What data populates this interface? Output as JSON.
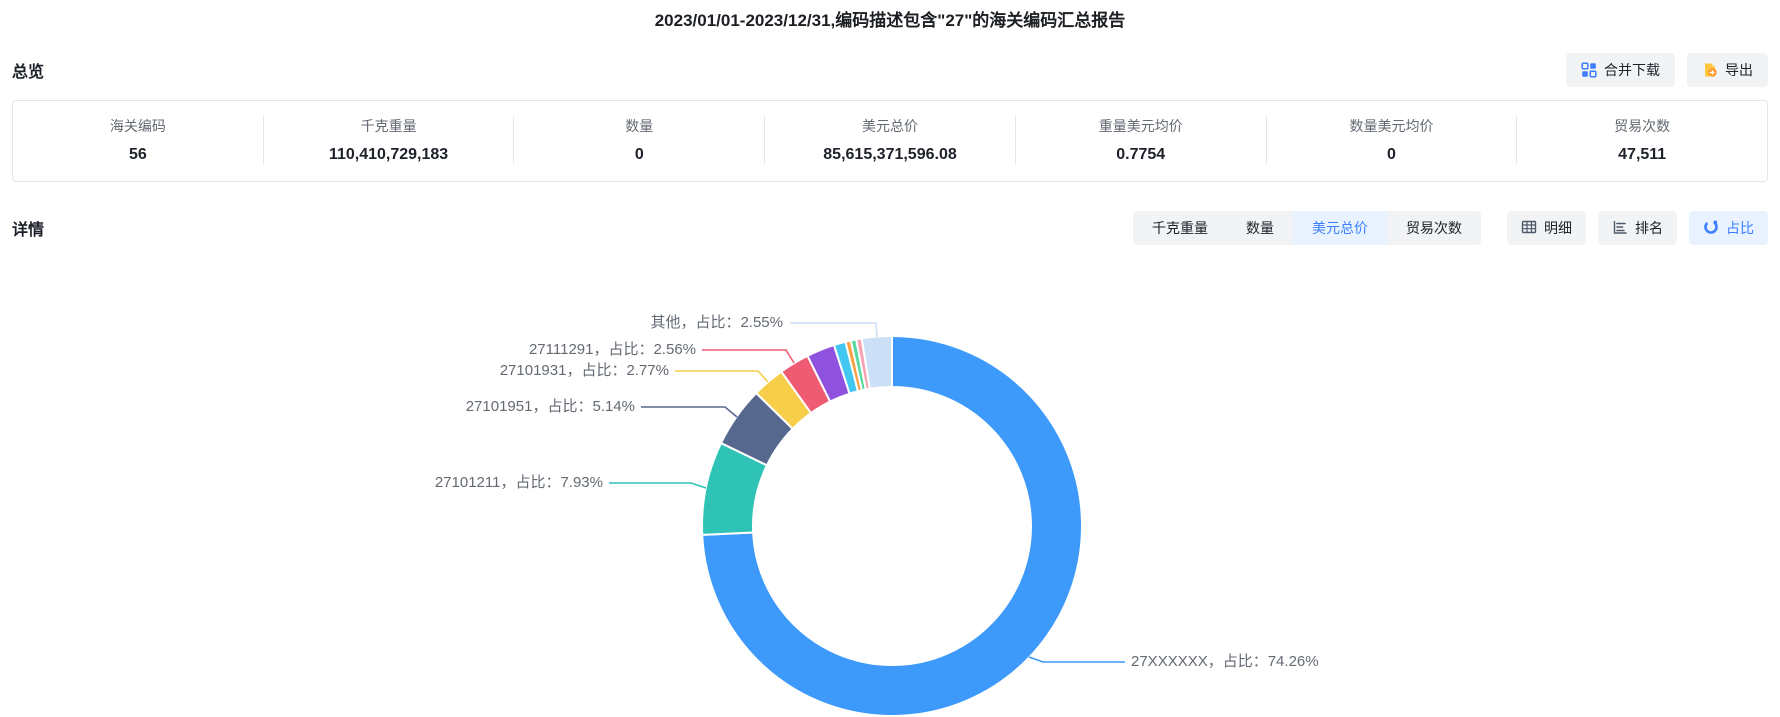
{
  "title": "2023/01/01-2023/12/31,编码描述包含\"27\"的海关编码汇总报告",
  "overview": {
    "heading": "总览",
    "buttons": {
      "merge_download": "合并下载",
      "export": "导出"
    },
    "stats": [
      {
        "label": "海关编码",
        "value": "56"
      },
      {
        "label": "千克重量",
        "value": "110,410,729,183"
      },
      {
        "label": "数量",
        "value": "0"
      },
      {
        "label": "美元总价",
        "value": "85,615,371,596.08"
      },
      {
        "label": "重量美元均价",
        "value": "0.7754"
      },
      {
        "label": "数量美元均价",
        "value": "0"
      },
      {
        "label": "贸易次数",
        "value": "47,511"
      }
    ]
  },
  "detail": {
    "heading": "详情",
    "metric_tabs": [
      {
        "label": "千克重量",
        "active": false
      },
      {
        "label": "数量",
        "active": false
      },
      {
        "label": "美元总价",
        "active": true
      },
      {
        "label": "贸易次数",
        "active": false
      }
    ],
    "view_buttons": [
      {
        "label": "明细",
        "active": false
      },
      {
        "label": "排名",
        "active": false
      },
      {
        "label": "占比",
        "active": true
      }
    ]
  },
  "colors": {
    "accent_blue": "#3d7fff",
    "active_tab_bg": "#e8f3ff",
    "tab_bg": "#f2f3f5",
    "card_border": "#e5e6eb",
    "label_gray": "#646a73",
    "export_icon_yellow": "#ffc53d",
    "export_icon_orange": "#ff9a2e"
  },
  "chart_data": {
    "type": "pie",
    "subtype": "donut",
    "unit": "percent of 美元总价",
    "legend": "none",
    "slices": [
      {
        "name": "27XXXXXX",
        "value": 74.26,
        "color": "#3d9afb",
        "display": "27XXXXXX，占比：74.26%"
      },
      {
        "name": "27101211",
        "value": 7.93,
        "color": "#2fc3b6",
        "display": "27101211，占比：7.93%"
      },
      {
        "name": "27101951",
        "value": 5.14,
        "color": "#56688e",
        "display": "27101951，占比：5.14%"
      },
      {
        "name": "27101931",
        "value": 2.77,
        "color": "#f6ce49",
        "display": "27101931，占比：2.77%"
      },
      {
        "name": "27111291",
        "value": 2.56,
        "color": "#ee5b72",
        "display": "27111291，占比：2.56%"
      },
      {
        "name": "",
        "value": 2.4,
        "color": "#8e52df",
        "display": ""
      },
      {
        "name": "",
        "value": 1.0,
        "color": "#41c7f0",
        "display": ""
      },
      {
        "name": "",
        "value": 0.46,
        "color": "#ff9f43",
        "display": ""
      },
      {
        "name": "",
        "value": 0.46,
        "color": "#57d9a3",
        "display": ""
      },
      {
        "name": "",
        "value": 0.47,
        "color": "#f8a3b2",
        "display": ""
      },
      {
        "name": "其他",
        "value": 2.55,
        "color": "#cbdff6",
        "display": "其他，占比：2.55%"
      }
    ]
  }
}
